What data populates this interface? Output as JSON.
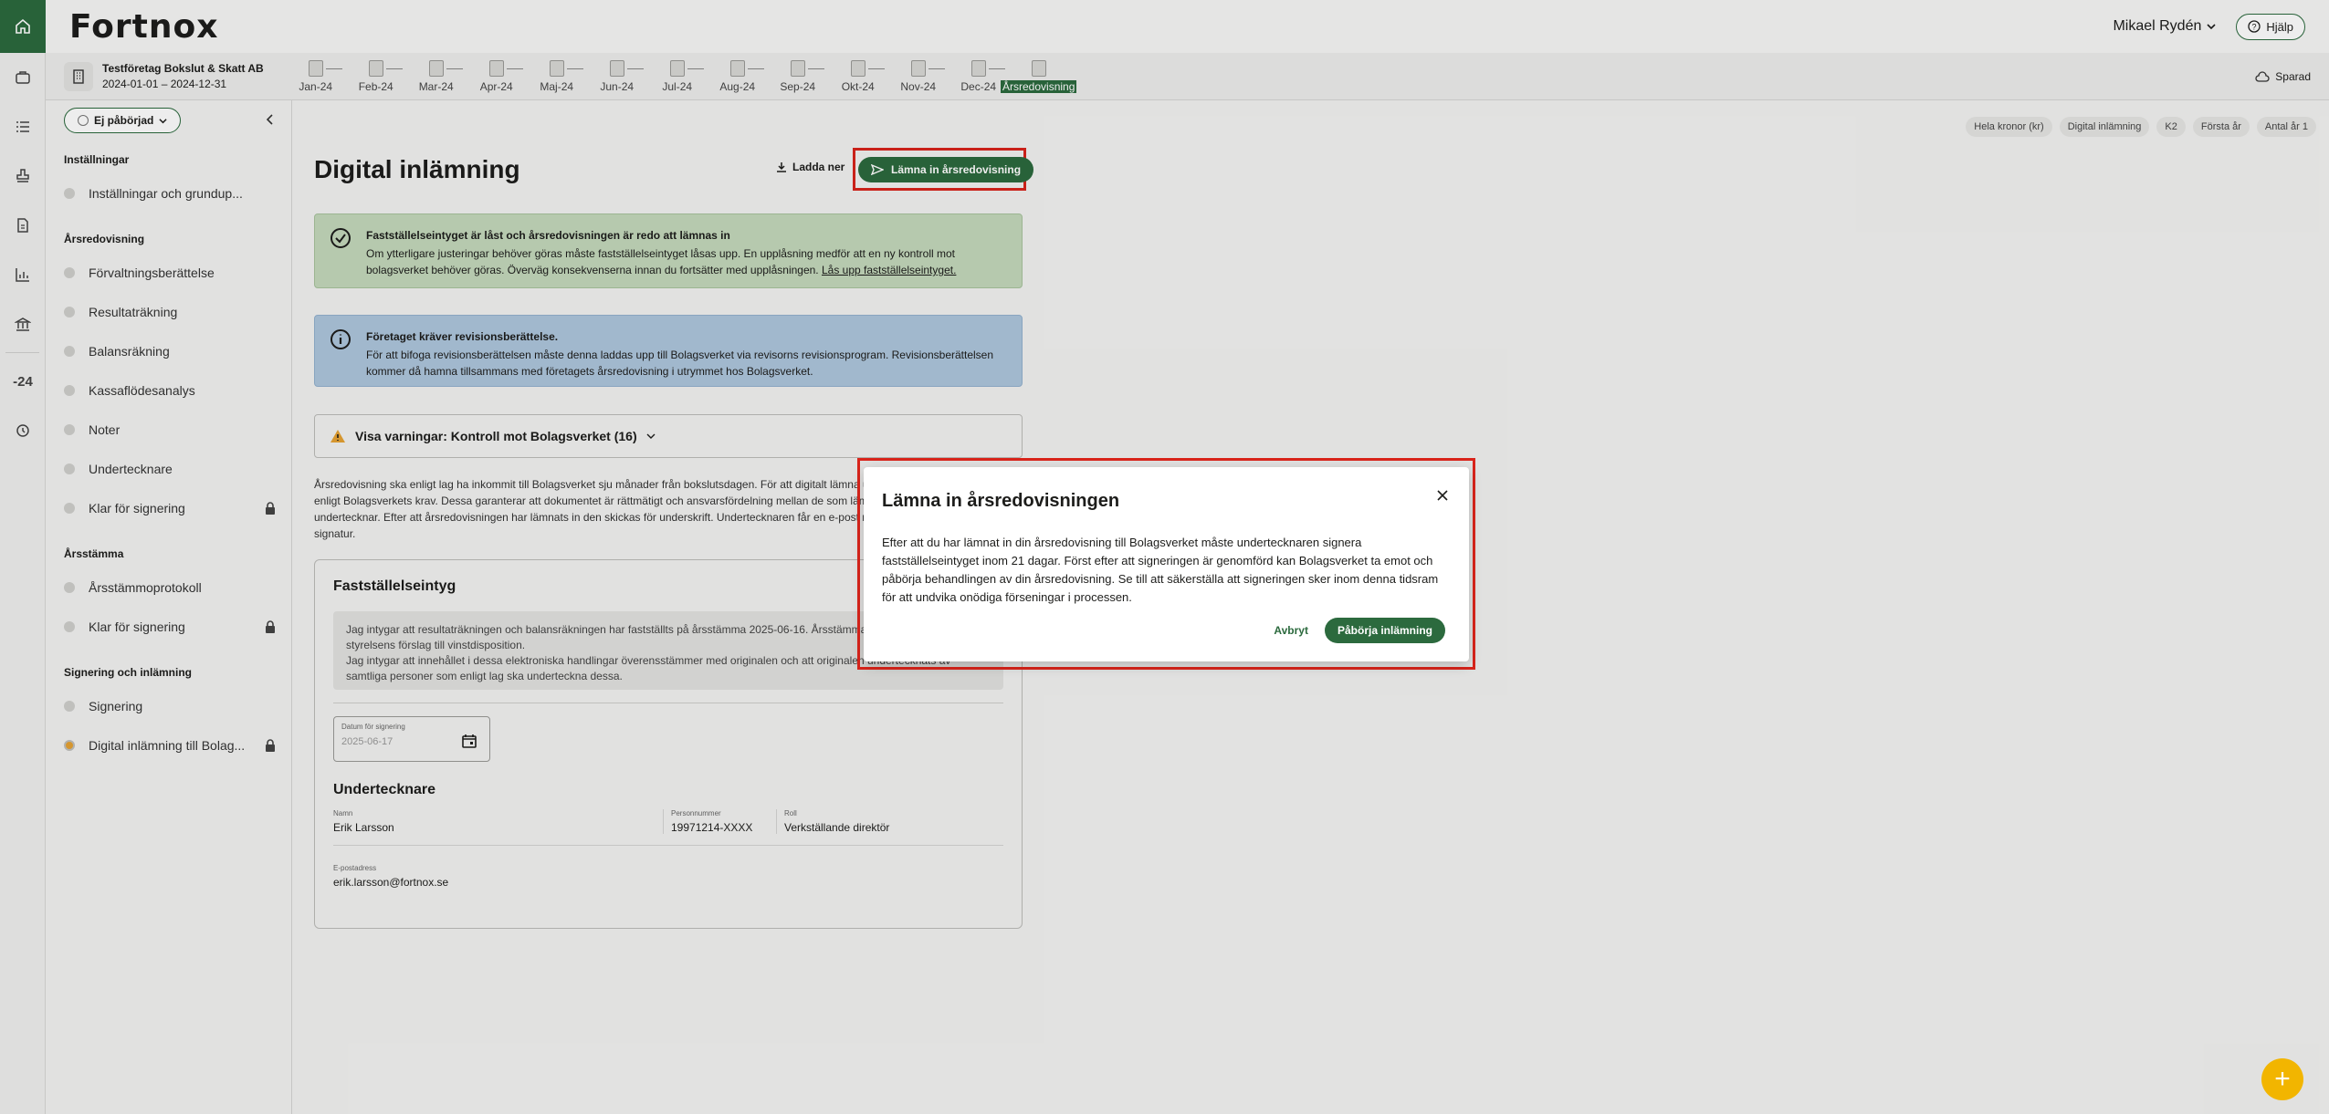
{
  "header": {
    "logo": "Fortnox",
    "user": "Mikael Rydén",
    "help": "Hjälp"
  },
  "company": {
    "name": "Testföretag Bokslut & Skatt AB",
    "dates": "2024-01-01 – 2024-12-31"
  },
  "periods": [
    "Jan-24",
    "Feb-24",
    "Mar-24",
    "Apr-24",
    "Maj-24",
    "Jun-24",
    "Jul-24",
    "Aug-24",
    "Sep-24",
    "Okt-24",
    "Nov-24",
    "Dec-24",
    "Årsredovisning"
  ],
  "saved": "Sparad",
  "rail": {
    "year": "-24"
  },
  "sidebar": {
    "status": "Ej påbörjad",
    "sections": [
      {
        "title": "Inställningar",
        "items": [
          {
            "label": "Inställningar och grundup..."
          }
        ]
      },
      {
        "title": "Årsredovisning",
        "items": [
          {
            "label": "Förvaltningsberättelse"
          },
          {
            "label": "Resultaträkning"
          },
          {
            "label": "Balansräkning"
          },
          {
            "label": "Kassaflödesanalys"
          },
          {
            "label": "Noter"
          },
          {
            "label": "Undertecknare"
          },
          {
            "label": "Klar för signering",
            "locked": true
          }
        ]
      },
      {
        "title": "Årsstämma",
        "items": [
          {
            "label": "Årsstämmoprotokoll"
          },
          {
            "label": "Klar för signering",
            "locked": true
          }
        ]
      },
      {
        "title": "Signering och inlämning",
        "items": [
          {
            "label": "Signering"
          },
          {
            "label": "Digital inlämning till Bolag...",
            "locked": true,
            "active": true
          }
        ]
      }
    ]
  },
  "chips": [
    "Hela kronor (kr)",
    "Digital inlämning",
    "K2",
    "Första år",
    "Antal år 1"
  ],
  "main": {
    "title": "Digital inlämning",
    "download": "Ladda ner",
    "submit": "Lämna in årsredovisning",
    "success_title": "Fastställelseintyget är låst och årsredovisningen är redo att lämnas in",
    "success_text": "Om ytterligare justeringar behöver göras måste fastställelseintyget låsas upp. En upplåsning medför att en ny kontroll mot bolagsverket behöver göras. Överväg konsekvenserna innan du fortsätter med upplåsningen.",
    "success_link": "Lås upp fastställelseintyget.",
    "info_title": "Företaget kräver revisionsberättelse.",
    "info_text": "För att bifoga revisionsberättelsen måste denna laddas upp till Bolagsverket via revisorns revisionsprogram. Revisionsberättelsen kommer då hamna tillsammans med företagets årsredovisning i utrymmet hos Bolagsverket.",
    "warnings": "Visa varningar: Kontroll mot Bolagsverket (16)",
    "body_text": "Årsredovisning ska enligt lag ha inkommit till Bolagsverket sju månader från bokslutsdagen. För att digitalt lämna undertecknare och en inlämnare enligt Bolagsverkets krav. Dessa garanterar att dokumentet är rättmätigt och ansvarsfördelning mellan de som lämnar in och de som undertecknar. Efter att årsredovisningen har lämnats in den skickas för underskrift. Undertecknaren får en e-post med en länk för att bekräfta sin signatur."
  },
  "card": {
    "title": "Fastställelseintyg",
    "quote_1": "Jag intygar att resultaträkningen och balansräkningen har fastställts på årsstämma 2025-06-16. Årsstämman beslöt att godkänna styrelsens förslag till vinstdisposition.",
    "quote_2": "Jag intygar att innehållet i dessa elektroniska handlingar överensstämmer med originalen och att originalen undertecknats av samtliga personer som enligt lag ska underteckna dessa.",
    "date_label": "Datum för signering",
    "date_value": "2025-06-17",
    "signers_title": "Undertecknare",
    "name_label": "Namn",
    "name": "Erik Larsson",
    "pnr_label": "Personnummer",
    "pnr": "19971214-XXXX",
    "role_label": "Roll",
    "role": "Verkställande direktör",
    "email_label": "E-postadress",
    "email": "erik.larsson@fortnox.se"
  },
  "modal": {
    "title": "Lämna in årsredovisningen",
    "text": "Efter att du har lämnat in din årsredovisning till Bolagsverket måste undertecknaren signera fastställelseintyget inom 21 dagar. Först efter att signeringen är genomförd kan Bolagsverket ta emot och påbörja behandlingen av din årsredovisning. Se till att säkerställa att signeringen sker inom denna tidsram för att undvika onödiga förseningar i processen.",
    "cancel": "Avbryt",
    "confirm": "Påbörja inlämning"
  },
  "fab": "+"
}
